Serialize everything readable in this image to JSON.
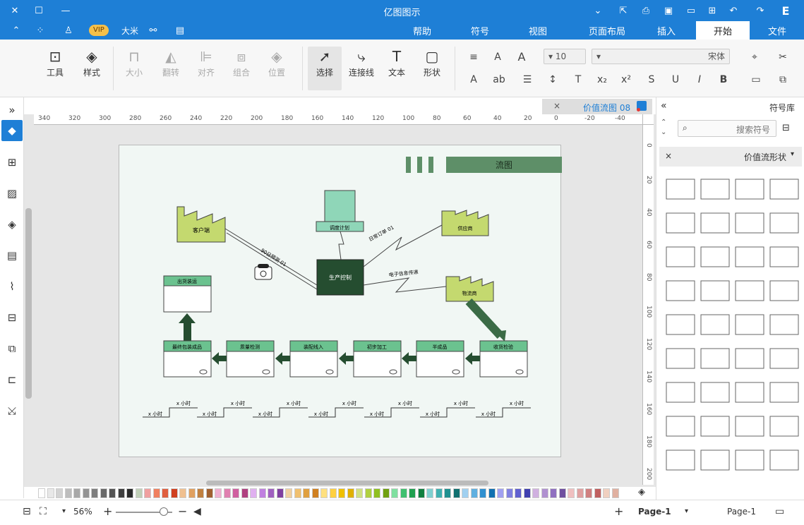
{
  "window": {
    "title": "亿图图示"
  },
  "menubar": {
    "tabs": [
      "文件",
      "开始",
      "插入",
      "页面布局",
      "视图",
      "符号",
      "帮助"
    ],
    "active_tab": "开始",
    "vip_label": "VIP",
    "user_label": "大米"
  },
  "toolbar": {
    "tool_label": "工具",
    "style_label": "样式",
    "size_label": "大小",
    "flip_label": "翻转",
    "align_label": "对齐",
    "group_label": "组合",
    "position_label": "位置",
    "select_label": "选择",
    "connector_label": "连接线",
    "text_label": "文本",
    "shape_label": "形状",
    "font_name": "宋体",
    "font_size": "10"
  },
  "document": {
    "tab_label": "价值流图 08",
    "tab_close": "×"
  },
  "ruler": {
    "h_ticks": [
      "340",
      "320",
      "300",
      "280",
      "260",
      "240",
      "220",
      "200",
      "180",
      "160",
      "140",
      "120",
      "100",
      "80",
      "60",
      "40",
      "20",
      "0",
      "-20",
      "-40"
    ],
    "v_ticks": [
      "0",
      "20",
      "40",
      "60",
      "80",
      "100",
      "120",
      "140",
      "160",
      "180",
      "200"
    ]
  },
  "diagram": {
    "title": "流图",
    "supplier": "客户端",
    "control": "生产控制",
    "schedule": "调度计划",
    "customer": "供应商",
    "cust2": "物流商",
    "forecast_label": "90日预测 01",
    "order_label": "日常订单 01",
    "etel_label1": "电子信息传递",
    "etel_label2": "电子信息传递",
    "boxes": [
      "收货检验",
      "半成品",
      "初步加工",
      "装配线入",
      "质量检测",
      "最终包装成品",
      "出货装运"
    ],
    "timeline": [
      "x 小时",
      "x 小时",
      "x 小时",
      "x 小时",
      "x 小时",
      "x 小时",
      "x 小时"
    ]
  },
  "palette": {
    "colors": [
      "#ffffff",
      "#e8e8e8",
      "#d2d2d2",
      "#bdbdbd",
      "#a8a8a8",
      "#939393",
      "#7e7e7e",
      "#696969",
      "#545454",
      "#3f3f3f",
      "#2a2a2a",
      "#c0d0b8",
      "#f0a0a0",
      "#f08060",
      "#e06040",
      "#d04020",
      "#f0c090",
      "#e0a060",
      "#c08040",
      "#a06030",
      "#f0b0d0",
      "#e080b0",
      "#d060a0",
      "#b04080",
      "#e0b0f0",
      "#c080e0",
      "#a060c0",
      "#8040a0",
      "#f0d0a0",
      "#f0c070",
      "#e0a040",
      "#d08020",
      "#ffe080",
      "#ffd040",
      "#f0c000",
      "#e0b000",
      "#d0e080",
      "#b0d040",
      "#90c020",
      "#70a010",
      "#80e0a0",
      "#40c070",
      "#20a050",
      "#108040",
      "#80d0d0",
      "#40b0b0",
      "#209090",
      "#107070",
      "#a0d0f0",
      "#60b0e0",
      "#3090d0",
      "#1070b0",
      "#a0a0f0",
      "#8080e0",
      "#6060d0",
      "#4040b0",
      "#d0b0e0",
      "#b090d0",
      "#9070c0",
      "#7050a0",
      "#f0c0c0",
      "#e0a0a0",
      "#d08080",
      "#c06060",
      "#f0d0c0",
      "#e0b0a0"
    ]
  },
  "status": {
    "page_select": "Page-1",
    "page_tab": "Page-1",
    "zoom": "56%"
  },
  "right_panel": {
    "title": "符号库",
    "search_placeholder": "搜索符号",
    "category": "价值流形状",
    "close": "×"
  }
}
